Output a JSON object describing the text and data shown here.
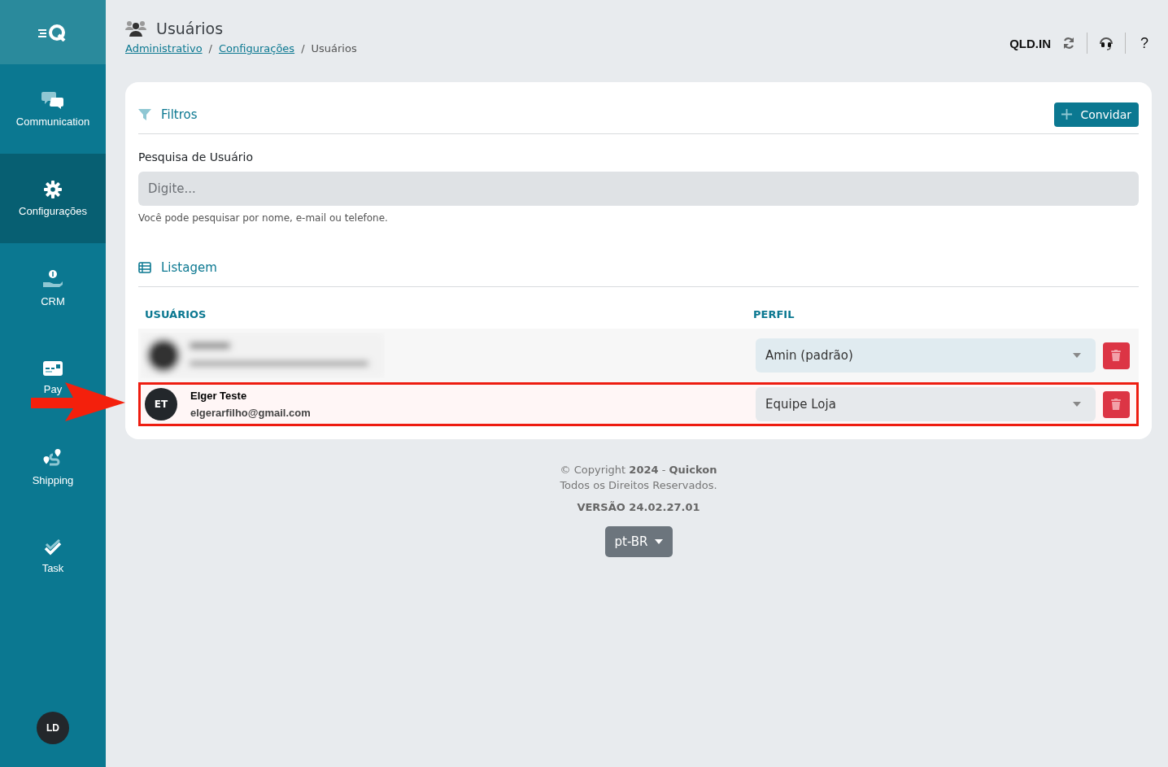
{
  "sidebar": {
    "items": [
      {
        "label": "Communication",
        "selected": false
      },
      {
        "label": "Configurações",
        "selected": true
      },
      {
        "label": "CRM",
        "selected": false
      },
      {
        "label": "Pay",
        "selected": false
      },
      {
        "label": "Shipping",
        "selected": false
      },
      {
        "label": "Task",
        "selected": false
      }
    ],
    "avatar": "LD"
  },
  "header": {
    "title": "Usuários",
    "breadcrumb": [
      {
        "label": "Administrativo",
        "link": true
      },
      {
        "label": "Configurações",
        "link": true
      },
      {
        "label": "Usuários",
        "link": false
      }
    ],
    "separator": "/",
    "company": "QLD.IN",
    "help": "?"
  },
  "filters": {
    "title": "Filtros",
    "invite_button": "Convidar",
    "search_label": "Pesquisa de Usuário",
    "search": {
      "placeholder": "Digite..."
    },
    "hint": "Você pode pesquisar por nome, e-mail ou telefone."
  },
  "listing": {
    "title": "Listagem",
    "columns": [
      "USUÁRIOS",
      "PERFIL"
    ],
    "rows": [
      {
        "kind": "redacted",
        "profile": "Amin (padrão)",
        "highlighted": false
      },
      {
        "kind": "user",
        "initials": "ET",
        "name": "Elger Teste",
        "email": "elgerarfilho@gmail.com",
        "profile": "Equipe Loja",
        "highlighted": true
      }
    ]
  },
  "footer": {
    "copyright": "© Copyright **2024** - **Quickon**",
    "rights": "Todos os Direitos Reservados.",
    "version": "VERSÃO 24.02.27.01",
    "language": "pt-BR"
  },
  "annotation": {
    "arrow": true
  }
}
